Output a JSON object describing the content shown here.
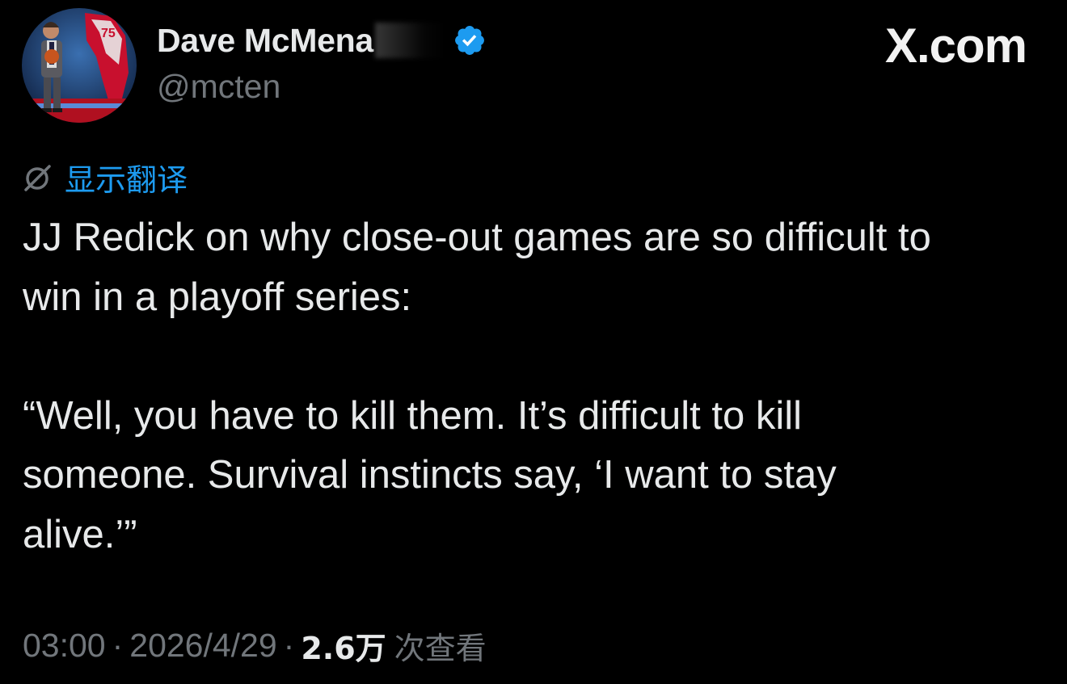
{
  "author": {
    "display_name": "Dave McMena",
    "handle": "@mcten",
    "verified": true
  },
  "site_logo": "X.com",
  "translate": {
    "label": "显示翻译",
    "icon": "translate-off-icon"
  },
  "tweet": {
    "lines": [
      "JJ Redick on why close-out games are so difficult to",
      "win in a playoff series:",
      "",
      "“Well, you have to kill them. It’s difficult to kill",
      "someone. Survival instincts say, ‘I want to stay",
      "alive.’”"
    ]
  },
  "meta": {
    "time": "03:00",
    "separator": "·",
    "date": "2026/4/29",
    "views_count": "2.6万",
    "views_label": "次查看"
  },
  "colors": {
    "background": "#000000",
    "text_primary": "#e7e9ea",
    "text_secondary": "#71767b",
    "accent": "#1d9bf0"
  }
}
